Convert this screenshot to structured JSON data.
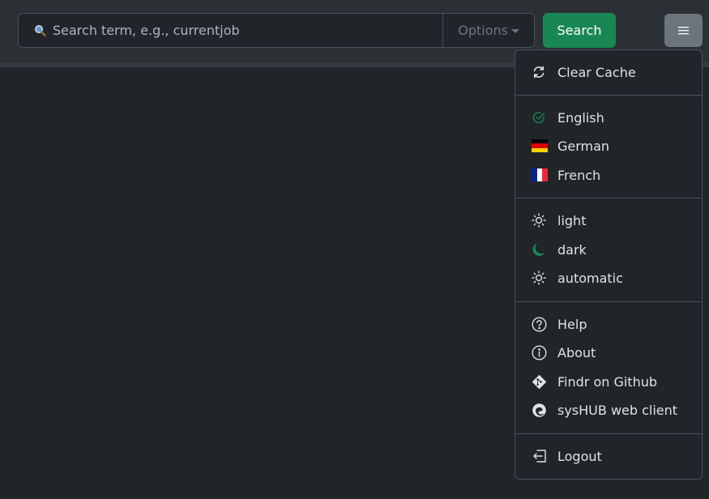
{
  "search": {
    "placeholder": "Search term, e.g., currentjob",
    "options_label": "Options",
    "button_label": "Search"
  },
  "menu": {
    "toggle_icon": "hamburger-icon",
    "items": [
      {
        "label": "Clear Cache",
        "icon": "refresh-icon"
      },
      {
        "label": "English",
        "icon": "check-circle-icon"
      },
      {
        "label": "German",
        "icon": "flag-de-icon"
      },
      {
        "label": "French",
        "icon": "flag-fr-icon"
      },
      {
        "label": "light",
        "icon": "sun-icon"
      },
      {
        "label": "dark",
        "icon": "moon-icon"
      },
      {
        "label": "automatic",
        "icon": "sun-icon"
      },
      {
        "label": "Help",
        "icon": "question-circle-icon"
      },
      {
        "label": "About",
        "icon": "info-circle-icon"
      },
      {
        "label": "Findr on Github",
        "icon": "git-icon"
      },
      {
        "label": "sysHUB web client",
        "icon": "edge-icon"
      },
      {
        "label": "Logout",
        "icon": "logout-icon"
      }
    ]
  },
  "colors": {
    "background": "#212529",
    "navbar": "#2b3035",
    "accent_green": "#198754",
    "menu_button": "#6c757d"
  }
}
